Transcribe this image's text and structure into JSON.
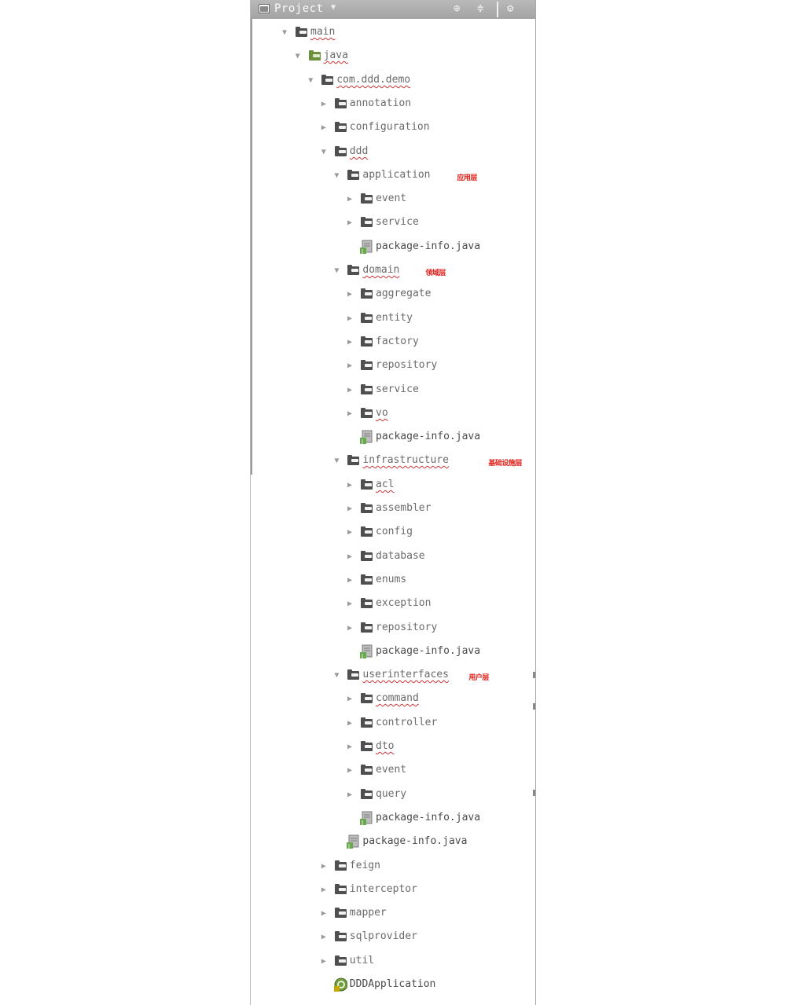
{
  "panel": {
    "title": "Project",
    "buttons": [
      {
        "name": "scroll-from-source",
        "glyph": "⊕"
      },
      {
        "name": "collapse-all",
        "glyph": "≑"
      },
      {
        "name": "settings",
        "glyph": "⚙"
      }
    ]
  },
  "tree": [
    {
      "label": "main",
      "kind": "folder",
      "level": 0,
      "expanded": true,
      "underline": true
    },
    {
      "label": "java",
      "kind": "source-folder",
      "level": 1,
      "expanded": true,
      "underline": true
    },
    {
      "label": "com.ddd.demo",
      "kind": "package",
      "level": 2,
      "expanded": true,
      "underline": true
    },
    {
      "label": "annotation",
      "kind": "package",
      "level": 3,
      "expanded": false
    },
    {
      "label": "configuration",
      "kind": "package",
      "level": 3,
      "expanded": false
    },
    {
      "label": "ddd",
      "kind": "package",
      "level": 3,
      "expanded": true,
      "underline": true
    },
    {
      "label": "application",
      "kind": "package",
      "level": 4,
      "expanded": true,
      "note": "应用层"
    },
    {
      "label": "event",
      "kind": "package",
      "level": 5,
      "expanded": false
    },
    {
      "label": "service",
      "kind": "package",
      "level": 5,
      "expanded": false
    },
    {
      "label": "package-info.java",
      "kind": "java-file",
      "level": 5
    },
    {
      "label": "domain",
      "kind": "package",
      "level": 4,
      "expanded": true,
      "underline": true,
      "note": "领域层"
    },
    {
      "label": "aggregate",
      "kind": "package",
      "level": 5,
      "expanded": false
    },
    {
      "label": "entity",
      "kind": "package",
      "level": 5,
      "expanded": false
    },
    {
      "label": "factory",
      "kind": "package",
      "level": 5,
      "expanded": false
    },
    {
      "label": "repository",
      "kind": "package",
      "level": 5,
      "expanded": false
    },
    {
      "label": "service",
      "kind": "package",
      "level": 5,
      "expanded": false
    },
    {
      "label": "vo",
      "kind": "package",
      "level": 5,
      "expanded": false,
      "underline": true
    },
    {
      "label": "package-info.java",
      "kind": "java-file",
      "level": 5
    },
    {
      "label": "infrastructure",
      "kind": "package",
      "level": 4,
      "expanded": true,
      "underline": true,
      "note": "基础设施层"
    },
    {
      "label": "acl",
      "kind": "package",
      "level": 5,
      "expanded": false,
      "underline": true
    },
    {
      "label": "assembler",
      "kind": "package",
      "level": 5,
      "expanded": false
    },
    {
      "label": "config",
      "kind": "package",
      "level": 5,
      "expanded": false
    },
    {
      "label": "database",
      "kind": "package",
      "level": 5,
      "expanded": false
    },
    {
      "label": "enums",
      "kind": "package",
      "level": 5,
      "expanded": false
    },
    {
      "label": "exception",
      "kind": "package",
      "level": 5,
      "expanded": false
    },
    {
      "label": "repository",
      "kind": "package",
      "level": 5,
      "expanded": false
    },
    {
      "label": "package-info.java",
      "kind": "java-file",
      "level": 5
    },
    {
      "label": "userinterfaces",
      "kind": "package",
      "level": 4,
      "expanded": true,
      "underline": true,
      "note": "用户层"
    },
    {
      "label": "command",
      "kind": "package",
      "level": 5,
      "expanded": false,
      "underline": true
    },
    {
      "label": "controller",
      "kind": "package",
      "level": 5,
      "expanded": false
    },
    {
      "label": "dto",
      "kind": "package",
      "level": 5,
      "expanded": false,
      "underline": true
    },
    {
      "label": "event",
      "kind": "package",
      "level": 5,
      "expanded": false
    },
    {
      "label": "query",
      "kind": "package",
      "level": 5,
      "expanded": false
    },
    {
      "label": "package-info.java",
      "kind": "java-file",
      "level": 5
    },
    {
      "label": "package-info.java",
      "kind": "java-file",
      "level": 4
    },
    {
      "label": "feign",
      "kind": "package",
      "level": 3,
      "expanded": false
    },
    {
      "label": "interceptor",
      "kind": "package",
      "level": 3,
      "expanded": false
    },
    {
      "label": "mapper",
      "kind": "package",
      "level": 3,
      "expanded": false
    },
    {
      "label": "sqlprovider",
      "kind": "package",
      "level": 3,
      "expanded": false
    },
    {
      "label": "util",
      "kind": "package",
      "level": 3,
      "expanded": false
    },
    {
      "label": "DDDApplication",
      "kind": "spring-class",
      "level": 3
    }
  ]
}
